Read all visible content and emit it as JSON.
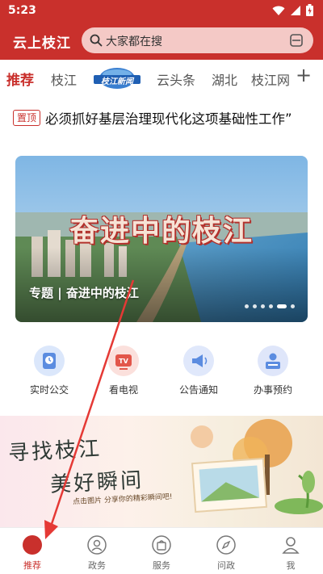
{
  "status_bar": {
    "time": "5:23"
  },
  "app_bar": {
    "title": "云上枝江",
    "search_placeholder": "大家都在搜"
  },
  "tabs": [
    {
      "label": "推荐",
      "active": true
    },
    {
      "label": "枝江"
    },
    {
      "label": "枝江新闻",
      "is_logo": true
    },
    {
      "label": "云头条"
    },
    {
      "label": "湖北"
    },
    {
      "label": "枝江网"
    }
  ],
  "tabs_more": "+",
  "pinned": {
    "badge": "置顶",
    "title": "必须抓好基层治理现代化这项基础性工作”"
  },
  "banner": {
    "headline": "奋进中的枝江",
    "caption": "专题 | 奋进中的枝江",
    "dot_count": 6,
    "active_dot": 4
  },
  "quick_services": [
    {
      "label": "实时公交",
      "icon": "bus-clock-icon"
    },
    {
      "label": "看电视",
      "icon": "tv-icon"
    },
    {
      "label": "公告通知",
      "icon": "megaphone-icon"
    },
    {
      "label": "办事预约",
      "icon": "appointment-icon"
    }
  ],
  "promo": {
    "line1": "寻找枝江",
    "line2": "美好瞬间",
    "line3": "点击图片 分享你的精彩瞬间吧!"
  },
  "bottom_nav": [
    {
      "label": "推荐",
      "icon": "recommend-icon",
      "active": true
    },
    {
      "label": "政务",
      "icon": "government-icon"
    },
    {
      "label": "服务",
      "icon": "service-bag-icon"
    },
    {
      "label": "问政",
      "icon": "compass-icon"
    },
    {
      "label": "我",
      "icon": "user-icon"
    }
  ],
  "colors": {
    "brand_red": "#c9302c",
    "search_bg": "#f4c9c6",
    "icon_blue": "#5b8ce0"
  }
}
